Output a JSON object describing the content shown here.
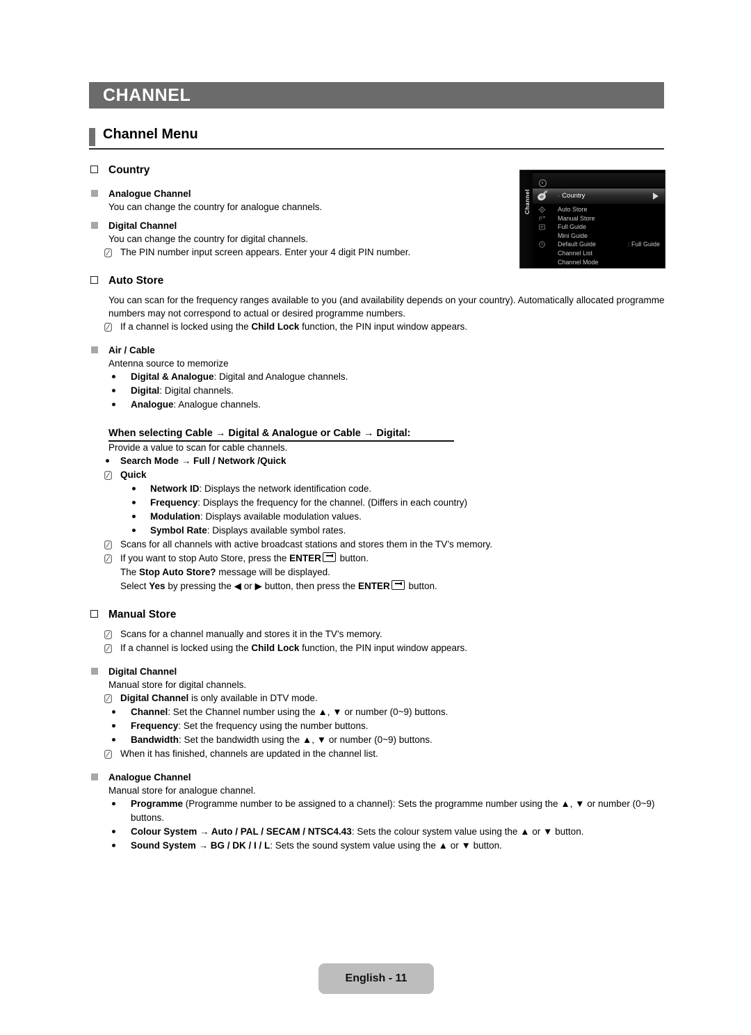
{
  "page": {
    "banner_title": "CHANNEL",
    "section_title": "Channel Menu",
    "footer_label": "English - 11"
  },
  "osd": {
    "side_label": "Channel",
    "selected_item": "Country",
    "items": [
      {
        "label": "Auto Store",
        "value": "",
        "icon": "gear-icon"
      },
      {
        "label": "Manual Store",
        "value": "",
        "icon": "antenna-icon"
      },
      {
        "label": "Full Guide",
        "value": "",
        "icon": "guide-icon"
      },
      {
        "label": "Mini Guide",
        "value": "",
        "icon": ""
      },
      {
        "label": "Default Guide",
        "value": ": Full Guide",
        "icon": "clock-icon"
      },
      {
        "label": "Channel List",
        "value": "",
        "icon": ""
      },
      {
        "label": "Channel Mode",
        "value": "",
        "icon": ""
      }
    ]
  },
  "country": {
    "heading": "Country",
    "analogue_heading": "Analogue Channel",
    "analogue_text": "You can change the country for analogue channels.",
    "digital_heading": "Digital Channel",
    "digital_text": "You can change the country for digital channels.",
    "digital_note": "The PIN number input screen appears. Enter your 4 digit PIN number."
  },
  "auto_store": {
    "heading": "Auto Store",
    "intro": "You can scan for the frequency ranges available to you (and availability depends on your country). Automatically allocated programme numbers may not correspond to actual or desired programme numbers.",
    "note_child_lock_pre": "If a channel is locked using the ",
    "note_child_lock_bold": "Child Lock",
    "note_child_lock_post": " function, the PIN input window appears.",
    "air_cable_heading": "Air / Cable",
    "air_cable_text": "Antenna source to memorize",
    "air_cable_options": [
      {
        "term": "Digital & Analogue",
        "desc": ": Digital and Analogue channels."
      },
      {
        "term": "Digital",
        "desc": ": Digital channels."
      },
      {
        "term": "Analogue",
        "desc": ": Analogue channels."
      }
    ],
    "cable_heading": "When selecting Cable → Digital & Analogue or Cable → Digital:",
    "cable_text": "Provide a value to scan for cable channels.",
    "search_mode": "Search Mode → Full / Network /Quick",
    "quick_label": "Quick",
    "quick_options": [
      {
        "term": "Network ID",
        "desc": ": Displays the network identification code."
      },
      {
        "term": "Frequency",
        "desc": ": Displays the frequency for the channel. (Differs in each country)"
      },
      {
        "term": "Modulation",
        "desc": ": Displays available modulation values."
      },
      {
        "term": "Symbol Rate",
        "desc": ": Displays available symbol rates."
      }
    ],
    "note_scan": "Scans for all channels with active broadcast stations and stores them in the TV’s memory.",
    "note_stop_pre": "If you want to stop Auto Store, press the ",
    "note_stop_bold": "ENTER",
    "note_stop_post": " button.",
    "stop_msg_pre": "The ",
    "stop_msg_bold": "Stop Auto Store?",
    "stop_msg_post": " message will be displayed.",
    "select_yes_pre": "Select ",
    "select_yes_bold": "Yes",
    "select_yes_mid": " by pressing the ◀ or ▶ button, then press the ",
    "select_yes_bold2": "ENTER",
    "select_yes_post": " button."
  },
  "manual_store": {
    "heading": "Manual Store",
    "note_scan": "Scans for a channel manually and stores it in the TV’s memory.",
    "note_child_lock_pre": "If a channel is locked using the ",
    "note_child_lock_bold": "Child Lock",
    "note_child_lock_post": " function, the PIN input window appears.",
    "digital_heading": "Digital Channel",
    "digital_text": "Manual store for digital channels.",
    "digital_note_bold": "Digital Channel",
    "digital_note_post": " is only available in DTV mode.",
    "digital_options": [
      {
        "term": "Channel",
        "desc": ": Set the Channel number using the ▲, ▼ or number (0~9) buttons."
      },
      {
        "term": "Frequency",
        "desc": ": Set the frequency using the number buttons."
      },
      {
        "term": "Bandwidth",
        "desc": ": Set the bandwidth using the ▲, ▼ or number (0~9) buttons."
      }
    ],
    "digital_note_finish": "When it has finished, channels are updated in the channel list.",
    "analogue_heading": "Analogue Channel",
    "analogue_text": "Manual store for analogue channel.",
    "analogue_options": [
      {
        "term": "Programme",
        "desc": " (Programme number to be assigned to a channel): Sets the programme number using the ▲, ▼ or number (0~9) buttons."
      },
      {
        "term": "Colour System → Auto / PAL / SECAM / NTSC4.43",
        "desc": ": Sets the colour system value using the ▲ or ▼ button."
      },
      {
        "term": "Sound System → BG / DK / I / L",
        "desc": ": Sets the sound system value using the ▲ or ▼ button."
      }
    ]
  }
}
